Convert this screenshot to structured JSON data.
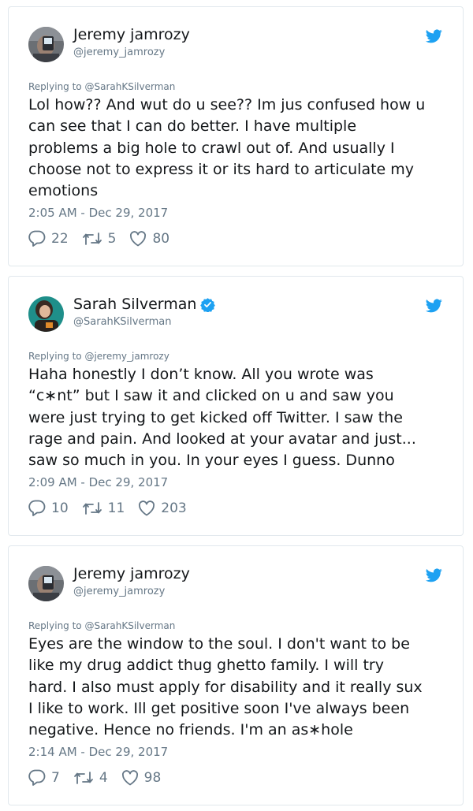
{
  "tweets": [
    {
      "name": "Jeremy jamrozy",
      "handle": "@jeremy_jamrozy",
      "verified": false,
      "replying_to": "Replying to @SarahKSilverman",
      "lines": [
        "Lol how?? And wut do u see?? Im jus confused how u",
        "can see that I can do better. I have multiple",
        "problems a big hole to crawl out of. And usually I",
        "choose not to express it or its hard to articulate my",
        "emotions"
      ],
      "timestamp": "2:05 AM - Dec 29, 2017",
      "replies": "22",
      "retweets": "5",
      "likes": "80"
    },
    {
      "name": "Sarah Silverman",
      "handle": "@SarahKSilverman",
      "verified": true,
      "replying_to": "Replying to @jeremy_jamrozy",
      "lines": [
        "Haha honestly I don’t know. All you wrote was",
        "“c∗nt” but I saw it and clicked on u and saw you",
        "were just trying to get kicked off Twitter. I saw the",
        "rage and pain. And looked at your avatar and just...",
        "saw so much in you. In your eyes I guess. Dunno"
      ],
      "timestamp": "2:09 AM - Dec 29, 2017",
      "replies": "10",
      "retweets": "11",
      "likes": "203"
    },
    {
      "name": "Jeremy jamrozy",
      "handle": "@jeremy_jamrozy",
      "verified": false,
      "replying_to": "Replying to @SarahKSilverman",
      "lines": [
        "Eyes are the window to the soul. I don't want to be",
        "like my drug addict thug ghetto family. I will try",
        "hard. I also must apply for disability and it really sux",
        "I like to work. Ill get positive soon I've always been",
        "negative. Hence no friends. I'm an as∗hole"
      ],
      "timestamp": "2:14 AM - Dec 29, 2017",
      "replies": "7",
      "retweets": "4",
      "likes": "98"
    }
  ],
  "colors": {
    "text": "#14171a",
    "muted": "#657786",
    "border": "#e1e8ed",
    "twitter_blue": "#1da1f2"
  },
  "icons": {
    "logo": "twitter-bird-icon",
    "reply": "reply-icon",
    "retweet": "retweet-icon",
    "like": "heart-icon",
    "verified": "verified-badge-icon"
  }
}
